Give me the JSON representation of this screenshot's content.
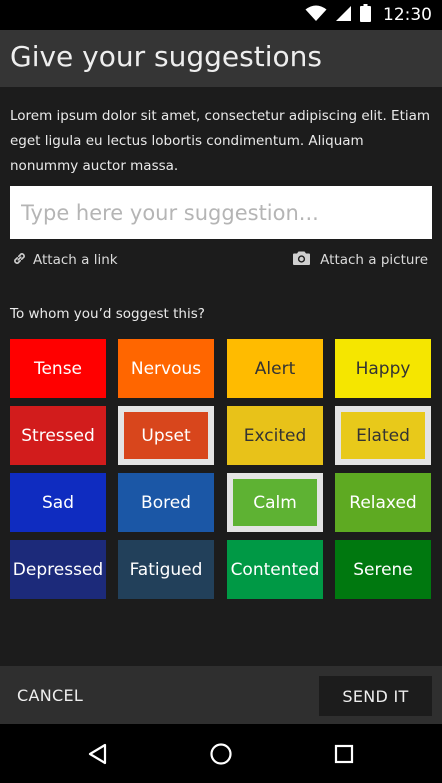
{
  "status_bar": {
    "time": "12:30"
  },
  "app_bar": {
    "title": "Give your suggestions"
  },
  "description": "Lorem ipsum dolor sit amet, consectetur adipiscing elit. Etiam eget ligula eu lectus lobortis condimentum. Aliquam nonummy auctor massa.",
  "suggestion": {
    "placeholder": "Type here your suggestion...",
    "value": ""
  },
  "attach": {
    "link_label": "Attach a link",
    "picture_label": "Attach a picture"
  },
  "whom_label": "To whom you’d soggest this?",
  "moods": [
    {
      "label": "Tense",
      "bg": "#ff0000",
      "fg": "#ffffff",
      "selected": false
    },
    {
      "label": "Nervous",
      "bg": "#ff6600",
      "fg": "#ffffff",
      "selected": false
    },
    {
      "label": "Alert",
      "bg": "#ffbb00",
      "fg": "#333333",
      "selected": false
    },
    {
      "label": "Happy",
      "bg": "#f5e600",
      "fg": "#333333",
      "selected": false
    },
    {
      "label": "Stressed",
      "bg": "#d21c1c",
      "fg": "#ffffff",
      "selected": false
    },
    {
      "label": "Upset",
      "bg": "#d8461c",
      "fg": "#ffffff",
      "selected": true
    },
    {
      "label": "Excited",
      "bg": "#e8c219",
      "fg": "#333333",
      "selected": false
    },
    {
      "label": "Elated",
      "bg": "#e8c91a",
      "fg": "#333333",
      "selected": true
    },
    {
      "label": "Sad",
      "bg": "#0f2cc0",
      "fg": "#ffffff",
      "selected": false
    },
    {
      "label": "Bored",
      "bg": "#1b57a6",
      "fg": "#ffffff",
      "selected": false
    },
    {
      "label": "Calm",
      "bg": "#5eb233",
      "fg": "#ffffff",
      "selected": true
    },
    {
      "label": "Relaxed",
      "bg": "#5eaa22",
      "fg": "#ffffff",
      "selected": false
    },
    {
      "label": "Depressed",
      "bg": "#1c2a7a",
      "fg": "#ffffff",
      "selected": false
    },
    {
      "label": "Fatigued",
      "bg": "#22405a",
      "fg": "#ffffff",
      "selected": false
    },
    {
      "label": "Contented",
      "bg": "#009945",
      "fg": "#ffffff",
      "selected": false
    },
    {
      "label": "Serene",
      "bg": "#00780f",
      "fg": "#ffffff",
      "selected": false
    }
  ],
  "actions": {
    "cancel_label": "CANCEL",
    "send_label": "SEND IT"
  },
  "icons": {
    "wifi": "wifi-icon",
    "signal": "signal-icon",
    "battery": "battery-icon",
    "link": "link-icon",
    "camera": "camera-icon",
    "back": "back-icon",
    "home": "home-icon",
    "recents": "recents-icon"
  }
}
